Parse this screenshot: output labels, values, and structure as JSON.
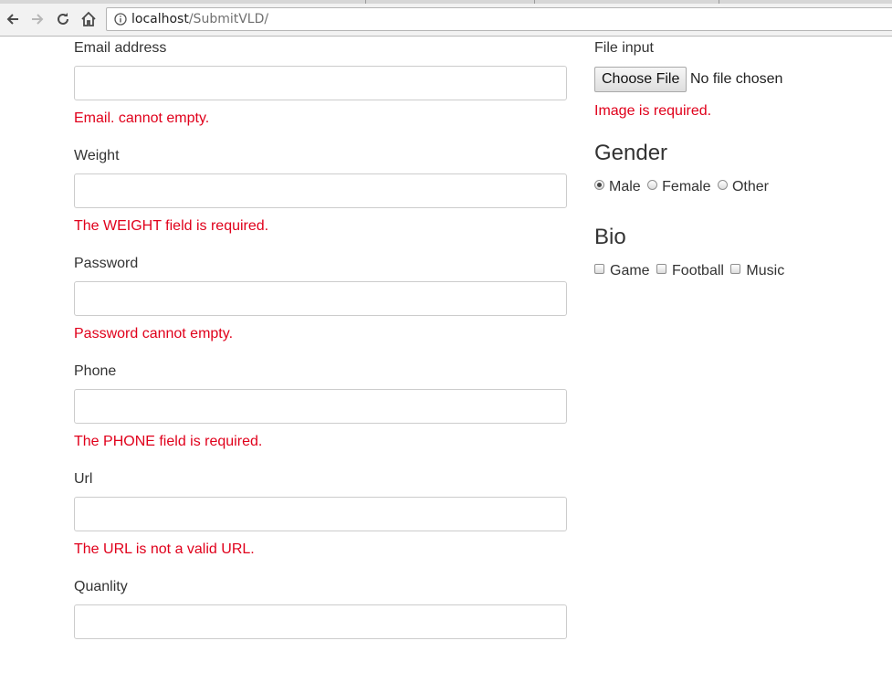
{
  "browser": {
    "url_host": "localhost",
    "url_path": "/SubmitVLD/"
  },
  "form": {
    "fields": [
      {
        "label": "Email address",
        "value": "",
        "error": "Email. cannot empty."
      },
      {
        "label": "Weight",
        "value": "",
        "error": "The WEIGHT field is required."
      },
      {
        "label": "Password",
        "value": "",
        "error": "Password cannot empty."
      },
      {
        "label": "Phone",
        "value": "",
        "error": "The PHONE field is required."
      },
      {
        "label": "Url",
        "value": "",
        "error": "The URL is not a valid URL."
      },
      {
        "label": "Quanlity",
        "value": ""
      }
    ],
    "file": {
      "label": "File input",
      "button": "Choose File",
      "status": "No file chosen",
      "error": "Image is required."
    },
    "gender": {
      "title": "Gender",
      "options": [
        "Male",
        "Female",
        "Other"
      ],
      "selected": "Male"
    },
    "bio": {
      "title": "Bio",
      "options": [
        "Game",
        "Football",
        "Music"
      ]
    }
  },
  "colors": {
    "error": "#e0001b",
    "text": "#333333"
  }
}
